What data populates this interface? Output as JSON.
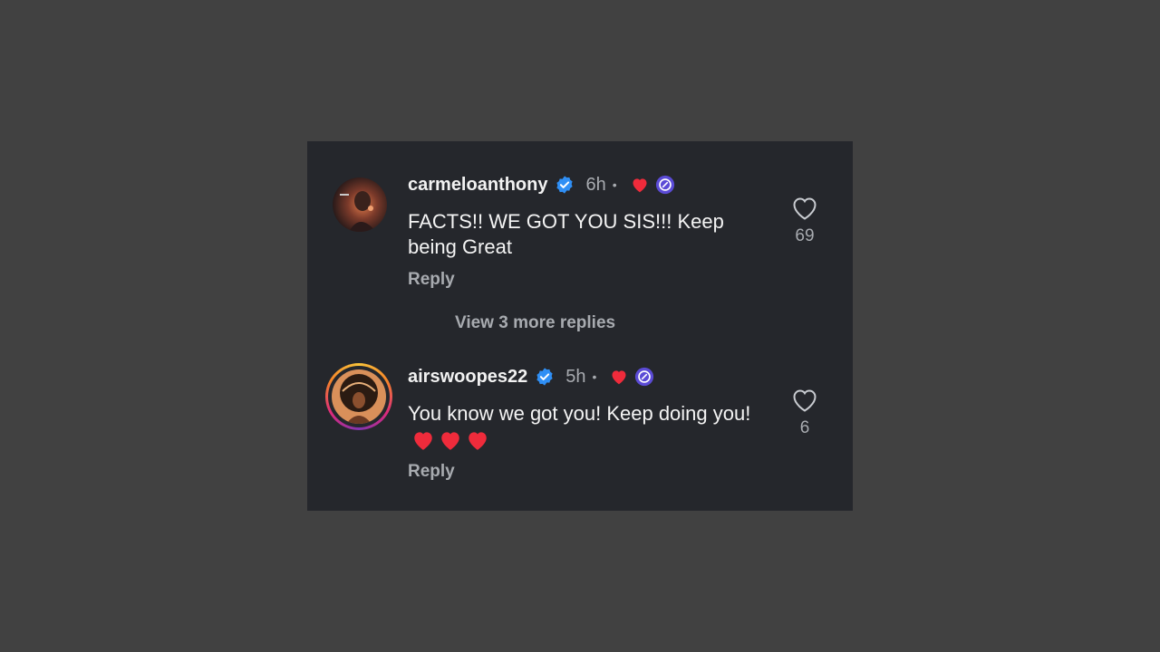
{
  "comments": [
    {
      "username": "carmeloanthony",
      "verified": true,
      "time": "6h",
      "separator": "•",
      "text": "FACTS!! WE GOT YOU SIS!!! Keep being Great",
      "reply_label": "Reply",
      "likes": "69",
      "avatar_icon": "profile-photo",
      "badges": [
        "creator-liked-heart-icon",
        "creator-badge-icon"
      ]
    },
    {
      "username": "airswoopes22",
      "verified": true,
      "time": "5h",
      "separator": "•",
      "text": "You know we got you! Keep doing you!",
      "text_emoji": "❤️❤️❤️",
      "reply_label": "Reply",
      "likes": "6",
      "avatar_icon": "profile-photo-with-story-ring",
      "badges": [
        "creator-liked-heart-icon",
        "creator-badge-icon"
      ]
    }
  ],
  "view_more_replies": "View 3 more replies",
  "colors": {
    "background": "#414141",
    "card": "#25272c",
    "verified_blue": "#2f8ff5",
    "heart_red": "#ef2b3b",
    "badge_purple": "#5b4bd6"
  }
}
